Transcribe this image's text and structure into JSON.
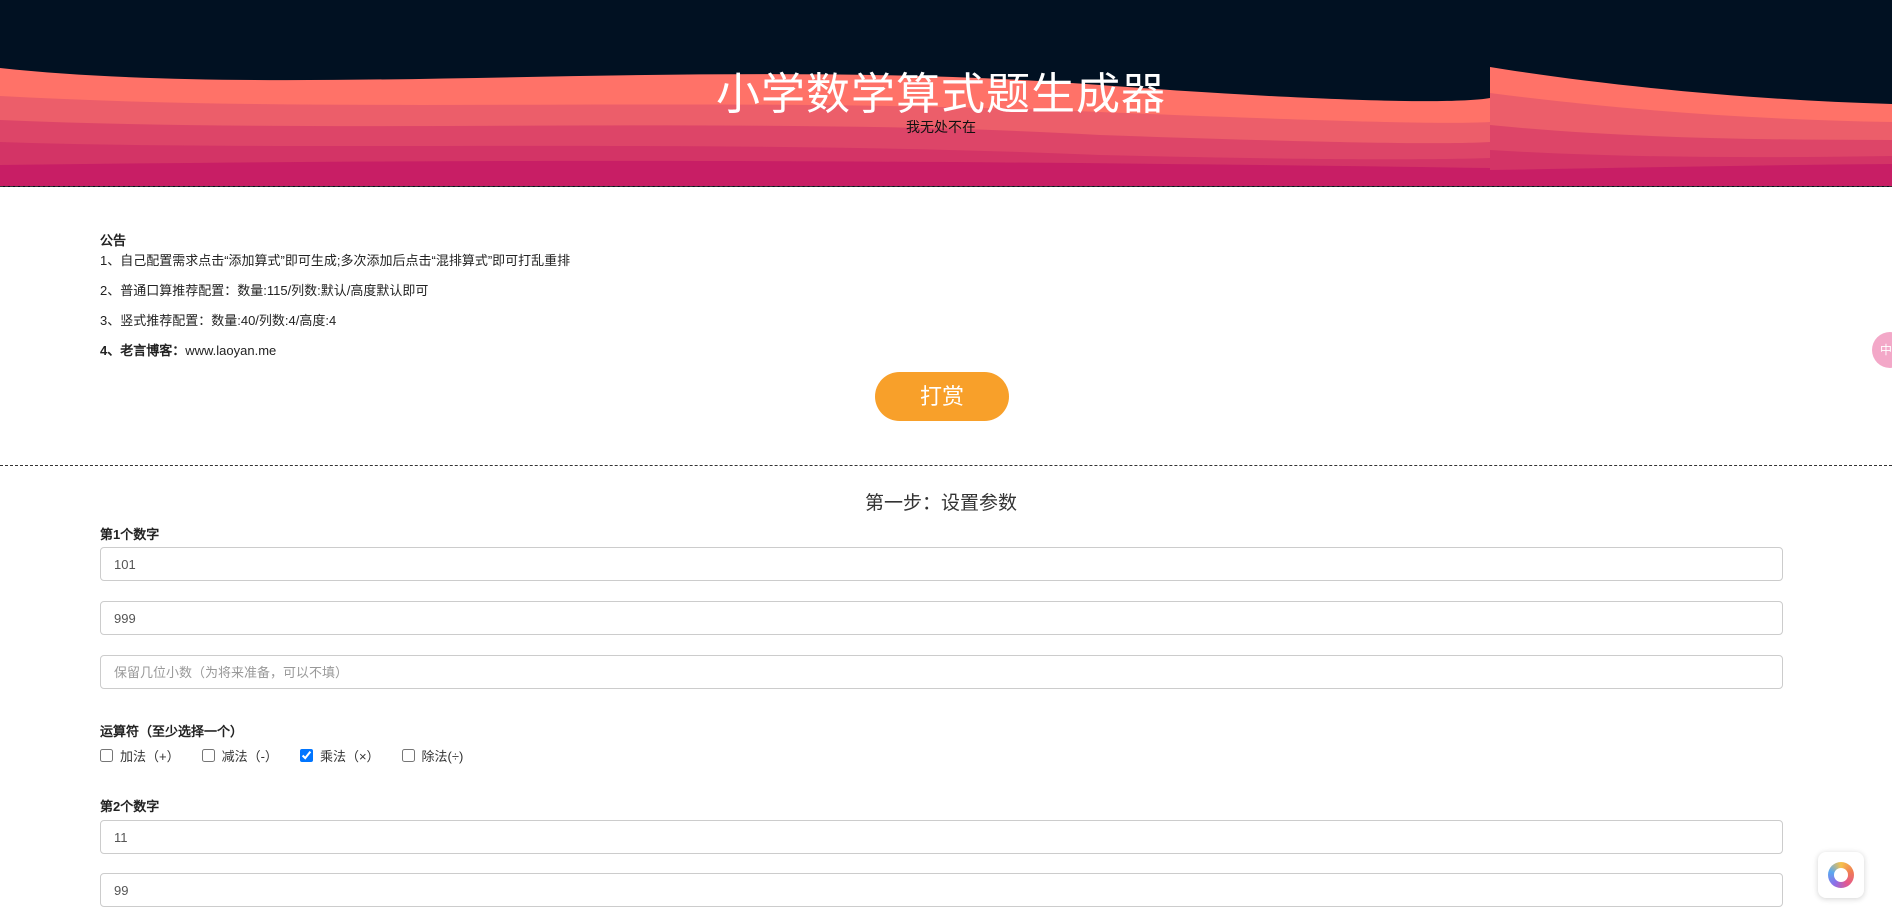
{
  "header": {
    "title": "小学数学算式题生成器",
    "subtitle": "我无处不在"
  },
  "notice": {
    "title": "公告",
    "line1": "1、自己配置需求点击“添加算式”即可生成;多次添加后点击“混排算式”即可打乱重排",
    "line2": "2、普通口算推荐配置：数量:115/列数:默认/高度默认即可",
    "line3": "3、竖式推荐配置：数量:40/列数:4/高度:4",
    "line4_prefix": "4、老言博客：",
    "line4_link": "www.laoyan.me"
  },
  "reward_button": "打赏",
  "step1": {
    "title": "第一步：设置参数",
    "first_number": {
      "label": "第1个数字",
      "min_value": "101",
      "max_value": "999",
      "decimal_placeholder": "保留几位小数（为将来准备，可以不填）"
    },
    "operators": {
      "label": "运算符（至少选择一个）",
      "items": [
        {
          "label": "加法（+）",
          "checked": false
        },
        {
          "label": "减法（-）",
          "checked": false
        },
        {
          "label": "乘法（×）",
          "checked": true
        },
        {
          "label": "除法(÷)",
          "checked": false
        }
      ]
    },
    "second_number": {
      "label": "第2个数字",
      "min_value": "11",
      "max_value": "99"
    }
  },
  "side_float_text": "中",
  "colors": {
    "header_bg": "#011122",
    "wave_light": "#ff7268",
    "wave_dark": "#c81e65",
    "reward_button": "#f8a02a"
  }
}
